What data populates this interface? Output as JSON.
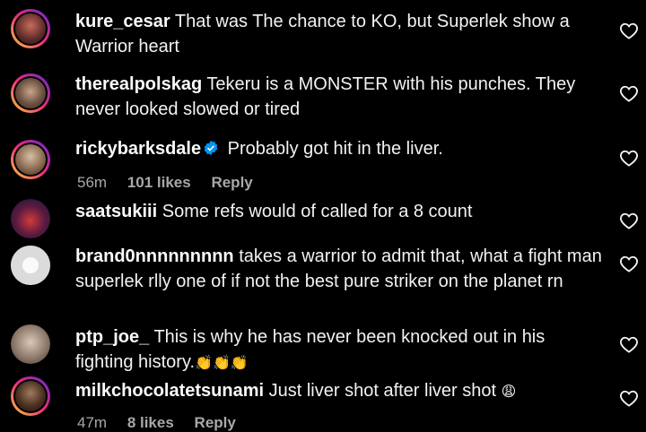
{
  "comments": [
    {
      "username": "kure_cesar",
      "text": "That was The chance to KO, but Superlek show a Warrior heart"
    },
    {
      "username": "therealpolskag",
      "text": "Tekeru is a MONSTER with his punches. They never looked slowed or tired"
    },
    {
      "username": "rickybarksdale",
      "text": "Probably got hit in the liver.",
      "time": "56m",
      "likes": "101 likes",
      "reply": "Reply"
    },
    {
      "username": "saatsukiii",
      "text": "Some refs would of called for a 8 count"
    },
    {
      "username": "brand0nnnnnnnnn",
      "text": "takes a warrior to admit that, what a fight man superlek rlly one of if not the best pure striker on the planet rn"
    },
    {
      "username": "ptp_joe_",
      "text": "This is why he has never been knocked out in his fighting history.",
      "emoji": "👏👏👏"
    },
    {
      "username": "milkchocolatetsunami",
      "text": "Just liver shot after liver shot",
      "emoji": "😩",
      "time": "47m",
      "likes": "8 likes",
      "reply": "Reply"
    }
  ],
  "icons": {
    "like": "heart-outline-icon",
    "verified": "verified-badge-icon"
  },
  "colors": {
    "background": "#000000",
    "text": "#f5f5f5",
    "meta": "#a8a8a8",
    "verified": "#0095f6"
  }
}
